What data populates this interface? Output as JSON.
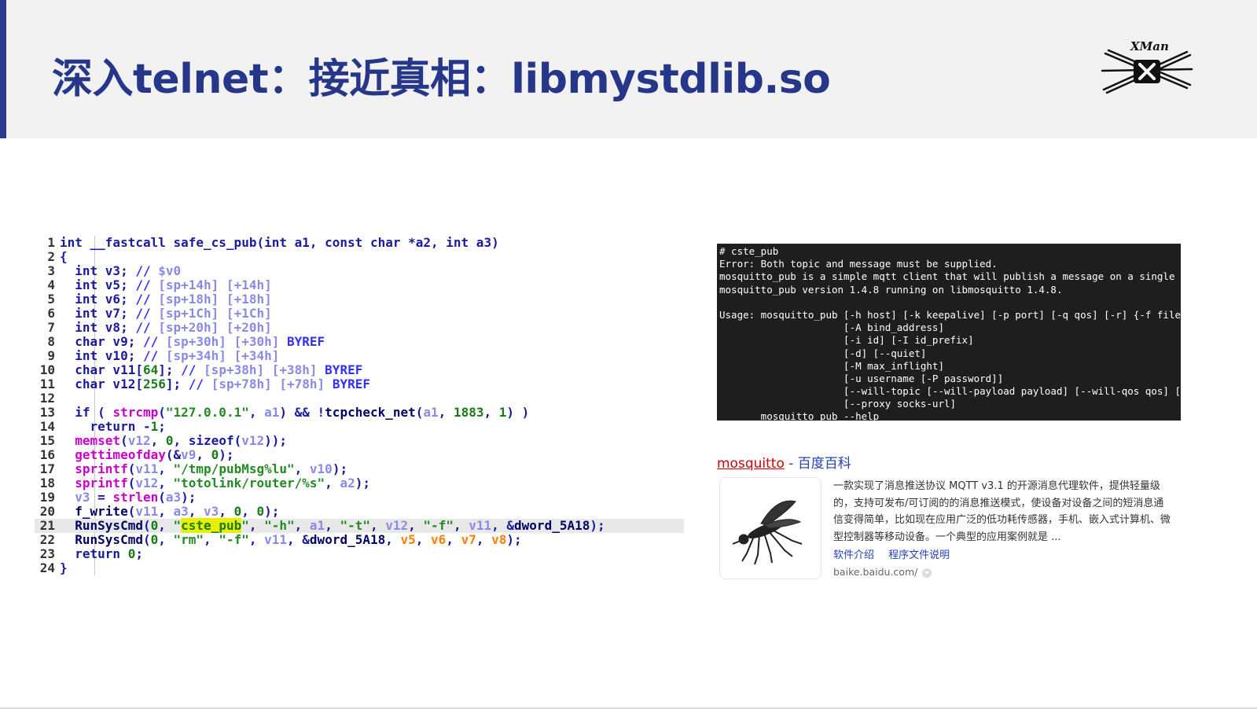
{
  "slide": {
    "title": "深入telnet：接近真相：libmystdlib.so",
    "logo_text": "XMan",
    "accent_color": "#2e3a8c",
    "title_color": "#26378a"
  },
  "code": {
    "lines": [
      {
        "n": "1",
        "tokens": [
          [
            "kw",
            "int __fastcall safe_cs_pub(int a1, const char *a2, int a3)"
          ]
        ]
      },
      {
        "n": "2",
        "tokens": [
          [
            "kw",
            "{"
          ]
        ]
      },
      {
        "n": "3",
        "tokens": [
          [
            "kw",
            "  int v3; "
          ],
          [
            "cm",
            "// "
          ],
          [
            "lv",
            "$v0"
          ]
        ]
      },
      {
        "n": "4",
        "tokens": [
          [
            "kw",
            "  int v5; "
          ],
          [
            "cm",
            "// "
          ],
          [
            "lv",
            "[sp+14h] [+14h]"
          ]
        ]
      },
      {
        "n": "5",
        "tokens": [
          [
            "kw",
            "  int v6; "
          ],
          [
            "cm",
            "// "
          ],
          [
            "lv",
            "[sp+18h] [+18h]"
          ]
        ]
      },
      {
        "n": "6",
        "tokens": [
          [
            "kw",
            "  int v7; "
          ],
          [
            "cm",
            "// "
          ],
          [
            "lv",
            "[sp+1Ch] [+1Ch]"
          ]
        ]
      },
      {
        "n": "7",
        "tokens": [
          [
            "kw",
            "  int v8; "
          ],
          [
            "cm",
            "// "
          ],
          [
            "lv",
            "[sp+20h] [+20h]"
          ]
        ]
      },
      {
        "n": "8",
        "tokens": [
          [
            "kw",
            "  char v9; "
          ],
          [
            "cm",
            "// "
          ],
          [
            "lv",
            "[sp+30h] [+30h] "
          ],
          [
            "cm",
            "BYREF"
          ]
        ]
      },
      {
        "n": "9",
        "tokens": [
          [
            "kw",
            "  int v10; "
          ],
          [
            "cm",
            "// "
          ],
          [
            "lv",
            "[sp+34h] [+34h]"
          ]
        ]
      },
      {
        "n": "10",
        "tokens": [
          [
            "kw",
            "  char v11["
          ],
          [
            "nm",
            "64"
          ],
          [
            "kw",
            "]; "
          ],
          [
            "cm",
            "// "
          ],
          [
            "lv",
            "[sp+38h] [+38h] "
          ],
          [
            "cm",
            "BYREF"
          ]
        ]
      },
      {
        "n": "11",
        "tokens": [
          [
            "kw",
            "  char v12["
          ],
          [
            "nm",
            "256"
          ],
          [
            "kw",
            "]; "
          ],
          [
            "cm",
            "// "
          ],
          [
            "lv",
            "[sp+78h] [+78h] "
          ],
          [
            "cm",
            "BYREF"
          ]
        ]
      },
      {
        "n": "12",
        "tokens": [
          [
            "kw",
            ""
          ]
        ]
      },
      {
        "n": "13",
        "tokens": [
          [
            "kw",
            "  if ( "
          ],
          [
            "fn",
            "strcmp"
          ],
          [
            "kw",
            "("
          ],
          [
            "st",
            "\"127.0.0.1\""
          ],
          [
            "kw",
            ", "
          ],
          [
            "lv",
            "a1"
          ],
          [
            "kw",
            ") && !"
          ],
          [
            "bk",
            "tcpcheck_net"
          ],
          [
            "kw",
            "("
          ],
          [
            "lv",
            "a1"
          ],
          [
            "kw",
            ", "
          ],
          [
            "nm",
            "1883"
          ],
          [
            "kw",
            ", "
          ],
          [
            "nm",
            "1"
          ],
          [
            "kw",
            ") )"
          ]
        ]
      },
      {
        "n": "14",
        "tokens": [
          [
            "kw",
            "    return -"
          ],
          [
            "nm",
            "1"
          ],
          [
            "kw",
            ";"
          ]
        ]
      },
      {
        "n": "15",
        "tokens": [
          [
            "fn",
            "  memset"
          ],
          [
            "kw",
            "("
          ],
          [
            "lv",
            "v12"
          ],
          [
            "kw",
            ", "
          ],
          [
            "nm",
            "0"
          ],
          [
            "kw",
            ", sizeof("
          ],
          [
            "lv",
            "v12"
          ],
          [
            "kw",
            "));"
          ]
        ]
      },
      {
        "n": "16",
        "tokens": [
          [
            "fn",
            "  gettimeofday"
          ],
          [
            "kw",
            "(&"
          ],
          [
            "lv",
            "v9"
          ],
          [
            "kw",
            ", "
          ],
          [
            "nm",
            "0"
          ],
          [
            "kw",
            ");"
          ]
        ]
      },
      {
        "n": "17",
        "tokens": [
          [
            "fn",
            "  sprintf"
          ],
          [
            "kw",
            "("
          ],
          [
            "lv",
            "v11"
          ],
          [
            "kw",
            ", "
          ],
          [
            "st",
            "\"/tmp/pubMsg%lu\""
          ],
          [
            "kw",
            ", "
          ],
          [
            "lv",
            "v10"
          ],
          [
            "kw",
            ");"
          ]
        ]
      },
      {
        "n": "18",
        "tokens": [
          [
            "fn",
            "  sprintf"
          ],
          [
            "kw",
            "("
          ],
          [
            "lv",
            "v12"
          ],
          [
            "kw",
            ", "
          ],
          [
            "st",
            "\"totolink/router/%s\""
          ],
          [
            "kw",
            ", "
          ],
          [
            "lv",
            "a2"
          ],
          [
            "kw",
            ");"
          ]
        ]
      },
      {
        "n": "19",
        "tokens": [
          [
            "lv",
            "  v3"
          ],
          [
            "kw",
            " = "
          ],
          [
            "fn",
            "strlen"
          ],
          [
            "kw",
            "("
          ],
          [
            "lv",
            "a3"
          ],
          [
            "kw",
            ");"
          ]
        ]
      },
      {
        "n": "20",
        "tokens": [
          [
            "bk",
            "  f_write"
          ],
          [
            "kw",
            "("
          ],
          [
            "lv",
            "v11"
          ],
          [
            "kw",
            ", "
          ],
          [
            "lv",
            "a3"
          ],
          [
            "kw",
            ", "
          ],
          [
            "lv",
            "v3"
          ],
          [
            "kw",
            ", "
          ],
          [
            "nm",
            "0"
          ],
          [
            "kw",
            ", "
          ],
          [
            "nm",
            "0"
          ],
          [
            "kw",
            ");"
          ]
        ]
      },
      {
        "n": "21",
        "hl": true,
        "tokens": [
          [
            "bk",
            "  RunSysCmd"
          ],
          [
            "kw",
            "("
          ],
          [
            "nm",
            "0"
          ],
          [
            "kw",
            ", "
          ],
          [
            "st",
            "\""
          ],
          [
            "hy",
            "cste_pub"
          ],
          [
            "st",
            "\""
          ],
          [
            "kw",
            ", "
          ],
          [
            "st",
            "\"-h\""
          ],
          [
            "kw",
            ", "
          ],
          [
            "lv",
            "a1"
          ],
          [
            "kw",
            ", "
          ],
          [
            "st",
            "\"-t\""
          ],
          [
            "kw",
            ", "
          ],
          [
            "lv",
            "v12"
          ],
          [
            "kw",
            ", "
          ],
          [
            "st",
            "\"-f\""
          ],
          [
            "kw",
            ", "
          ],
          [
            "lv",
            "v11"
          ],
          [
            "kw",
            ", &"
          ],
          [
            "bk",
            "dword_5A18"
          ],
          [
            "kw",
            ");"
          ]
        ]
      },
      {
        "n": "22",
        "tokens": [
          [
            "bk",
            "  RunSysCmd"
          ],
          [
            "kw",
            "("
          ],
          [
            "nm",
            "0"
          ],
          [
            "kw",
            ", "
          ],
          [
            "st",
            "\"rm\""
          ],
          [
            "kw",
            ", "
          ],
          [
            "st",
            "\"-f\""
          ],
          [
            "kw",
            ", "
          ],
          [
            "lv",
            "v11"
          ],
          [
            "kw",
            ", &"
          ],
          [
            "bk",
            "dword_5A18"
          ],
          [
            "kw",
            ", "
          ],
          [
            "or",
            "v5"
          ],
          [
            "kw",
            ", "
          ],
          [
            "or",
            "v6"
          ],
          [
            "kw",
            ", "
          ],
          [
            "or",
            "v7"
          ],
          [
            "kw",
            ", "
          ],
          [
            "or",
            "v8"
          ],
          [
            "kw",
            ");"
          ]
        ]
      },
      {
        "n": "23",
        "tokens": [
          [
            "kw",
            "  return "
          ],
          [
            "nm",
            "0"
          ],
          [
            "kw",
            ";"
          ]
        ]
      },
      {
        "n": "24",
        "tokens": [
          [
            "kw",
            "}"
          ]
        ]
      }
    ]
  },
  "terminal": {
    "lines": [
      "# cste_pub",
      "Error: Both topic and message must be supplied.",
      "mosquitto_pub is a simple mqtt client that will publish a message on a single top",
      "mosquitto_pub version 1.4.8 running on libmosquitto 1.4.8.",
      "",
      "Usage: mosquitto_pub [-h host] [-k keepalive] [-p port] [-q qos] [-r] {-f file |",
      "                     [-A bind_address]",
      "                     [-i id] [-I id_prefix]",
      "                     [-d] [--quiet]",
      "                     [-M max_inflight]",
      "                     [-u username [-P password]]",
      "                     [--will-topic [--will-payload payload] [--will-qos qos] [--w",
      "                     [--proxy socks-url]",
      "       mosquitto_pub --help"
    ]
  },
  "baike": {
    "title_link": "mosquitto",
    "title_rest": " - 百度百科",
    "description": "一款实现了消息推送协议 MQTT v3.1 的开源消息代理软件，提供轻量级的，支持可发布/可订阅的的消息推送模式，使设备对设备之间的短消息通信变得简单，比如现在应用广泛的低功耗传感器，手机、嵌入式计算机、微型控制器等移动设备。一个典型的应用案例就是 ...",
    "links": [
      "软件介绍",
      "程序文件说明"
    ],
    "source": "baike.baidu.com/"
  }
}
